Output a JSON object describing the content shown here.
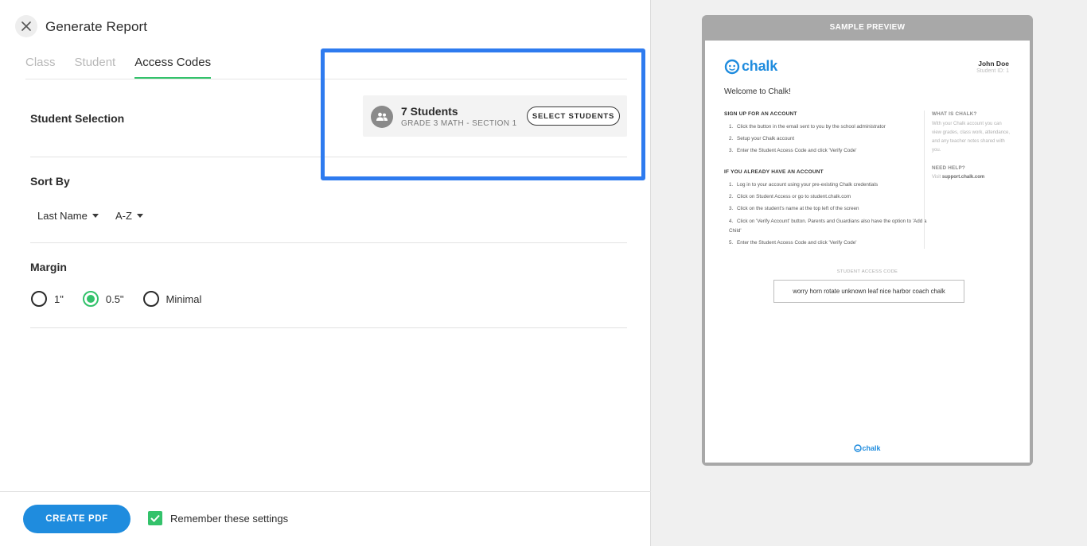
{
  "header": {
    "title": "Generate Report"
  },
  "tabs": [
    {
      "label": "Class",
      "active": false
    },
    {
      "label": "Student",
      "active": false
    },
    {
      "label": "Access Codes",
      "active": true
    }
  ],
  "student_selection": {
    "label": "Student Selection",
    "count_text": "7 Students",
    "section_text": "GRADE 3 MATH - SECTION 1",
    "button_label": "SELECT STUDENTS"
  },
  "sort_by": {
    "label": "Sort By",
    "field_value": "Last Name",
    "order_value": "A-Z"
  },
  "margin": {
    "label": "Margin",
    "options": [
      {
        "label": "1\"",
        "checked": false
      },
      {
        "label": "0.5\"",
        "checked": true
      },
      {
        "label": "Minimal",
        "checked": false
      }
    ]
  },
  "footer": {
    "create_label": "CREATE PDF",
    "remember_label": "Remember these settings",
    "remember_checked": true
  },
  "colors": {
    "accent_green": "#33c26b",
    "primary_blue": "#1f8cde",
    "highlight_blue": "#2e7bef"
  },
  "preview": {
    "title": "SAMPLE PREVIEW",
    "logo_text": "chalk",
    "student_name": "John Doe",
    "student_id": "Student ID: 1",
    "welcome": "Welcome to Chalk!",
    "signup_heading": "SIGN UP FOR AN ACCOUNT",
    "signup_steps": [
      {
        "n": "1.",
        "text": "Click the button in the email sent to you by the school administrator"
      },
      {
        "n": "2.",
        "text": "Setup your Chalk account"
      },
      {
        "n": "3.",
        "text": "Enter the Student Access Code and click 'Verify Code'"
      }
    ],
    "existing_heading": "IF YOU ALREADY HAVE AN ACCOUNT",
    "existing_steps": [
      {
        "n": "1.",
        "text": "Log in to your account using your pre-existing Chalk credentials"
      },
      {
        "n": "2.",
        "text": "Click on Student Access or go to student.chalk.com"
      },
      {
        "n": "3.",
        "text": "Click on the student's name at the top left of the screen"
      },
      {
        "n": "4.",
        "text": "Click on 'Verify Account' button. Parents and Guardians also have the option to 'Add a Child'"
      },
      {
        "n": "5.",
        "text": "Enter the Student Access Code and click 'Verify Code'"
      }
    ],
    "what_heading": "WHAT IS CHALK?",
    "what_text": "With your Chalk account you can view grades, class work, attendance, and any teacher notes shared with you.",
    "help_heading": "NEED HELP?",
    "help_prefix": "Visit",
    "help_link": "support.chalk.com",
    "code_label": "STUDENT ACCESS CODE",
    "code_value": "worry horn rotate unknown leaf nice harbor coach chalk",
    "footer_logo_text": "chalk"
  }
}
